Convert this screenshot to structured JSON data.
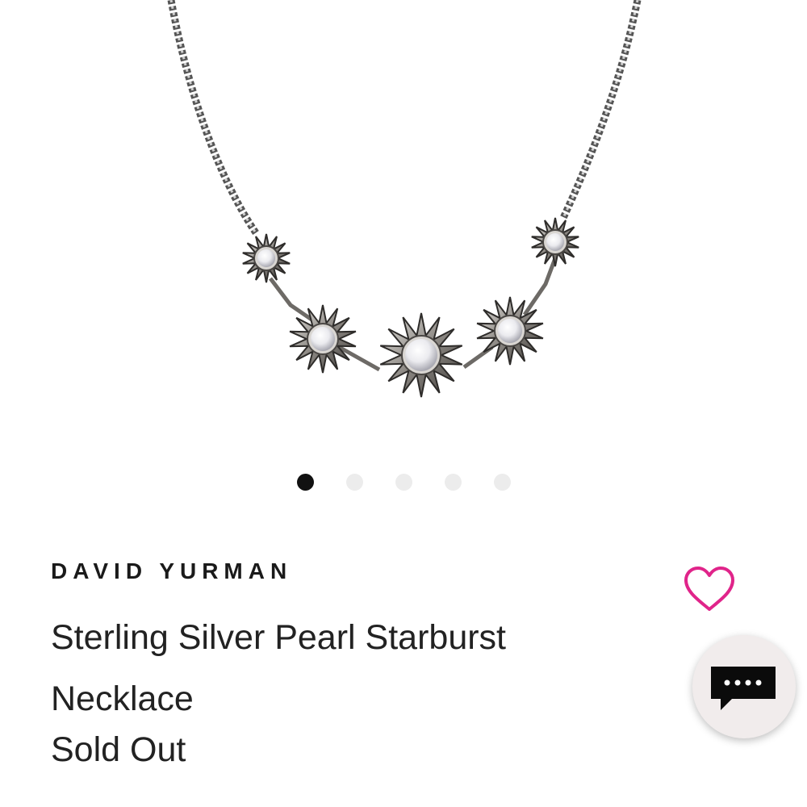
{
  "product": {
    "brand": "DAVID YURMAN",
    "title_line1": "Sterling Silver Pearl Starburst",
    "title_line2": "Necklace",
    "status": "Sold Out"
  },
  "carousel": {
    "total_images": 5,
    "active_index": 0
  },
  "icons": {
    "wishlist": "heart-outline-icon",
    "chat": "chat-bubble-icon"
  },
  "colors": {
    "wishlist_accent": "#e0248a",
    "active_dot": "#111111",
    "inactive_dot": "#ececec",
    "chat_bg": "#f1ecec"
  }
}
